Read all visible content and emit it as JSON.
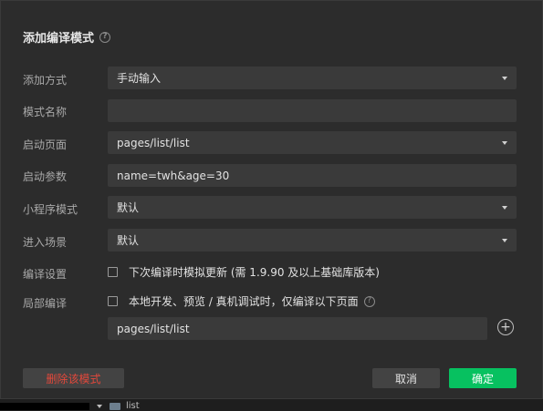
{
  "dialog": {
    "title": "添加编译模式",
    "help_icon_text": "?",
    "rows": {
      "add_method": {
        "label": "添加方式",
        "value": "手动输入"
      },
      "mode_name": {
        "label": "模式名称",
        "value": ""
      },
      "start_page": {
        "label": "启动页面",
        "value": "pages/list/list"
      },
      "start_params": {
        "label": "启动参数",
        "value": "name=twh&age=30"
      },
      "miniprogram_mode": {
        "label": "小程序模式",
        "value": "默认"
      },
      "enter_scene": {
        "label": "进入场景",
        "value": "默认"
      },
      "compile_settings": {
        "label": "编译设置",
        "checkbox_text": "下次编译时模拟更新 (需 1.9.90 及以上基础库版本)"
      },
      "partial_compile": {
        "label": "局部编译",
        "checkbox_text": "本地开发、预览 / 真机调试时，仅编译以下页面",
        "page_value": "pages/list/list"
      }
    },
    "buttons": {
      "delete": "删除该模式",
      "cancel": "取消",
      "ok": "确定"
    },
    "plus_icon_text": "+"
  },
  "background": {
    "tree_item": "list"
  },
  "colors": {
    "accent_green": "#07c160",
    "danger_red": "#e3483b",
    "panel": "#2c2c2c",
    "field": "#3a3a3a"
  }
}
